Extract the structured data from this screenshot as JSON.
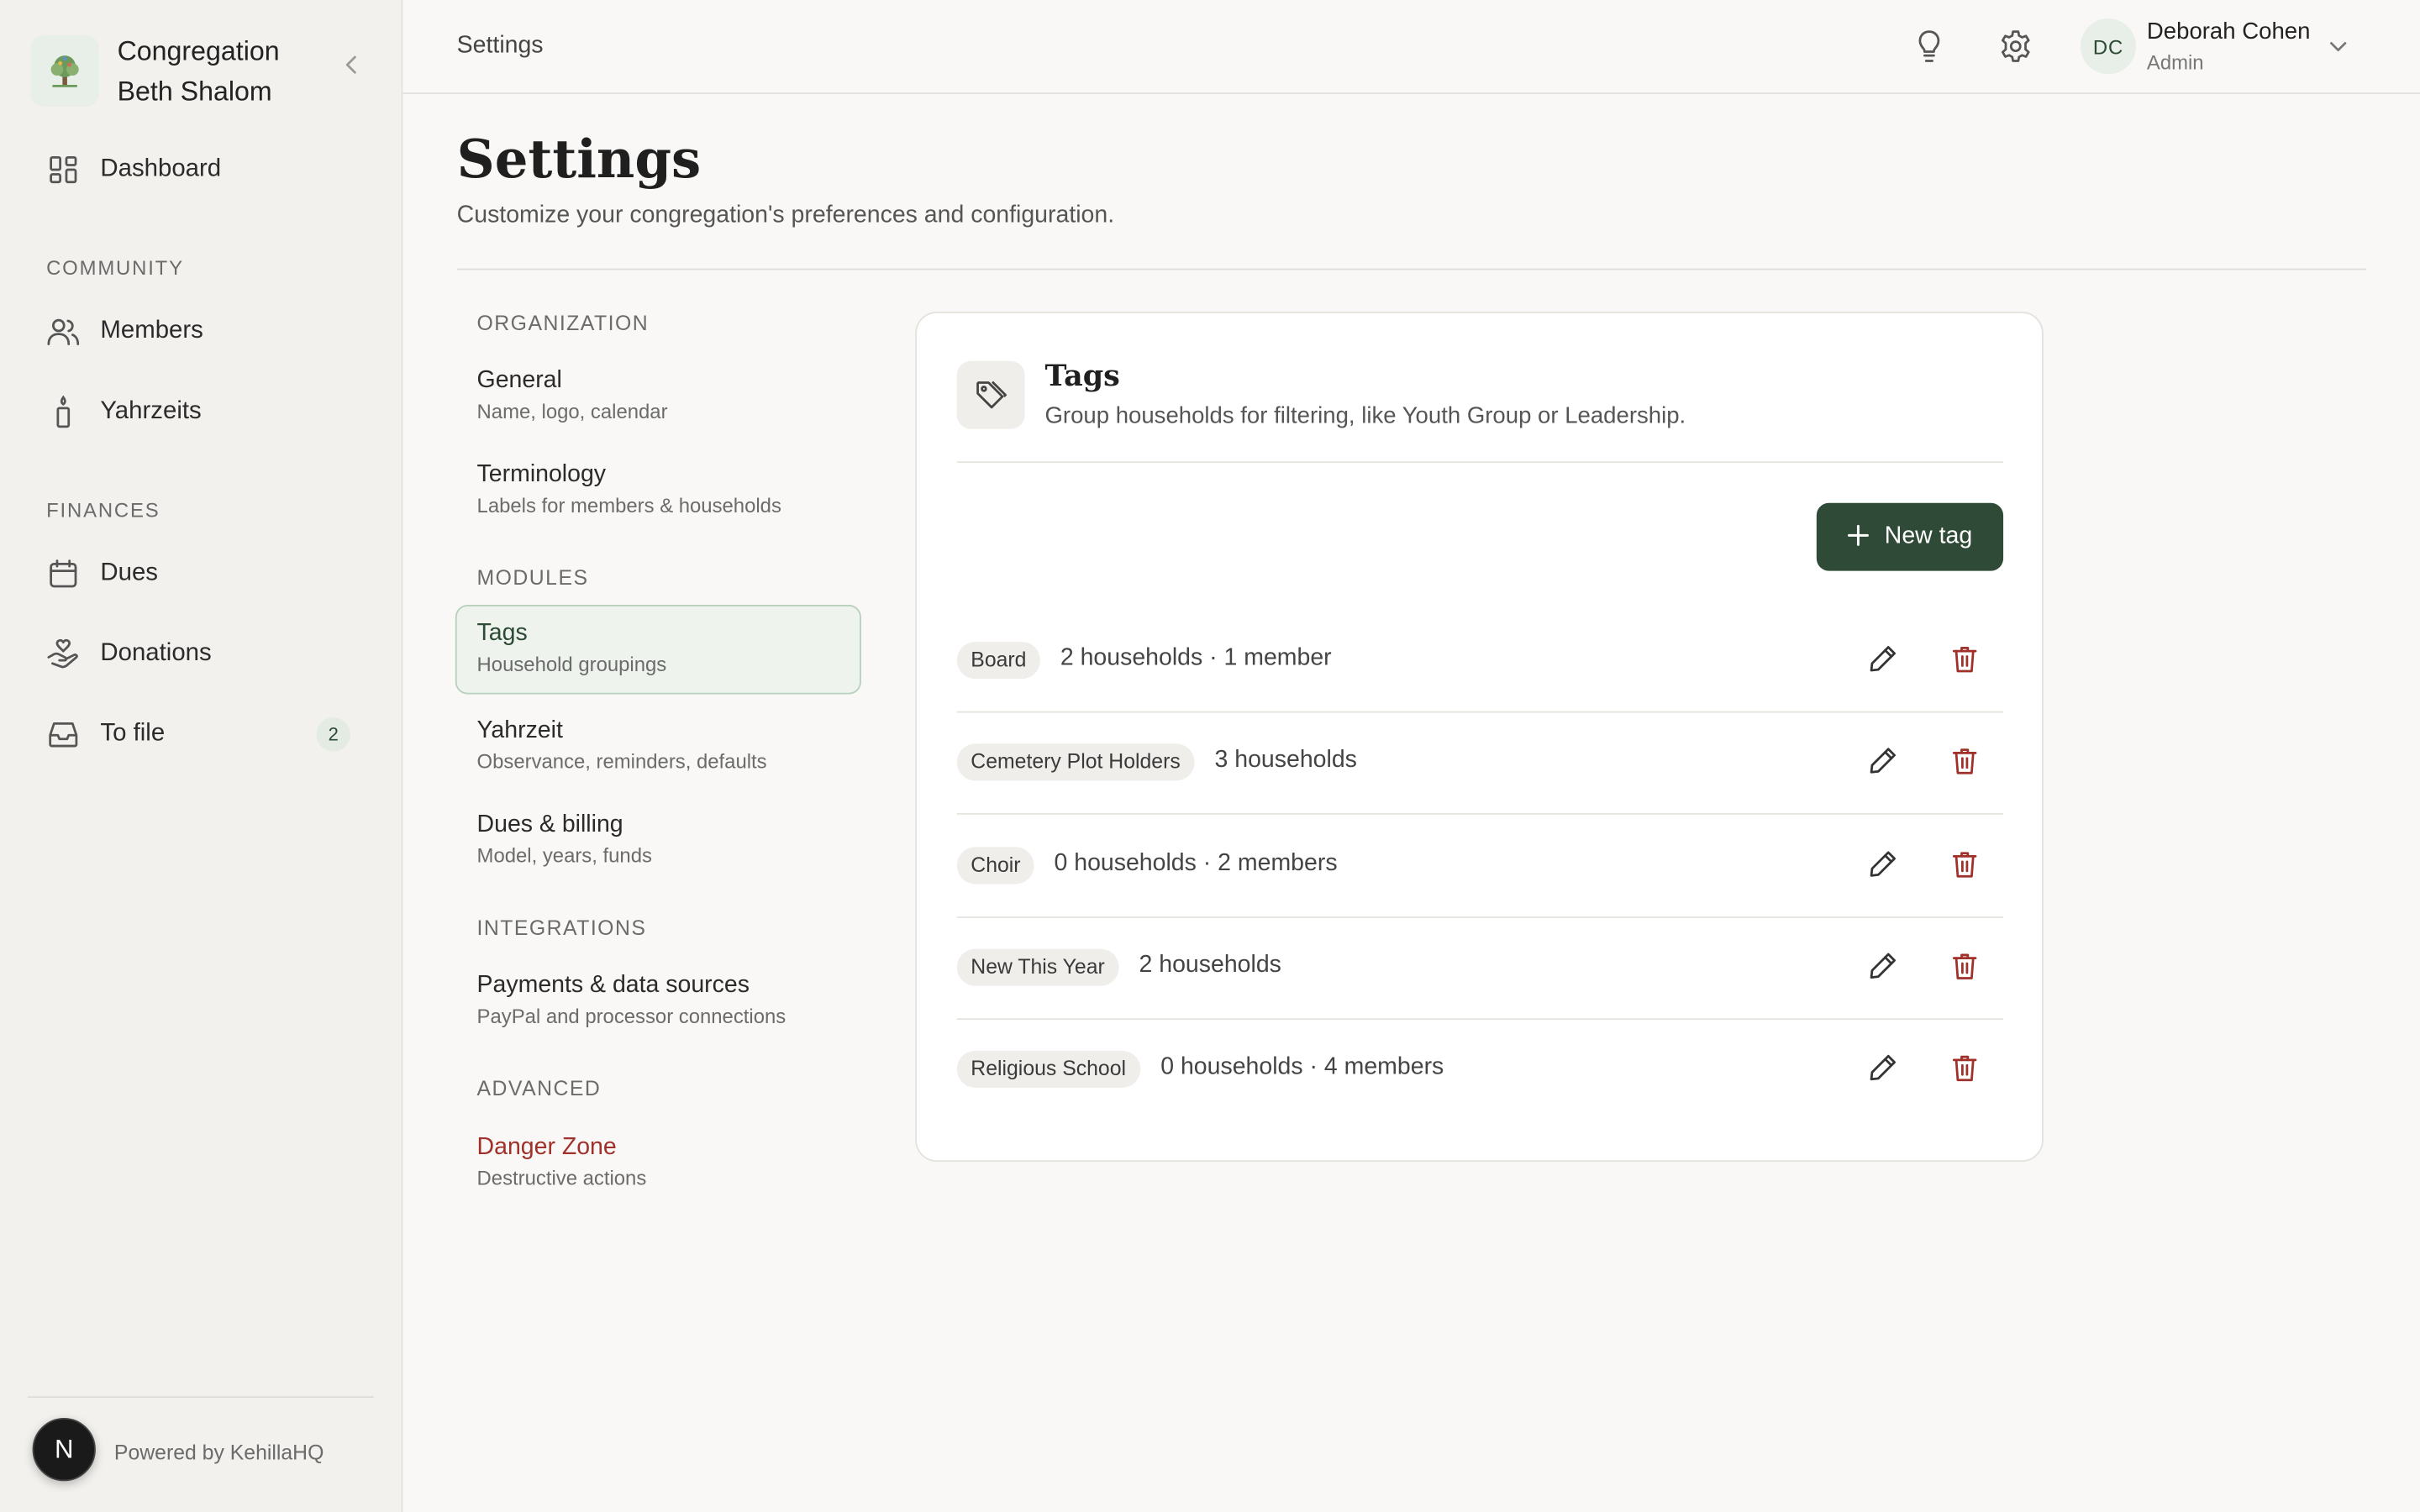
{
  "app": {
    "org_name": "Congregation Beth Shalom",
    "powered_by": "Powered by KehillaHQ",
    "footer_avatar": "N"
  },
  "sidebar": {
    "dashboard": "Dashboard",
    "sections": {
      "community": "COMMUNITY",
      "finances": "FINANCES"
    },
    "items": {
      "members": "Members",
      "yahrzeits": "Yahrzeits",
      "dues": "Dues",
      "donations": "Donations",
      "to_file": "To file",
      "to_file_count": "2"
    }
  },
  "topbar": {
    "breadcrumb": "Settings",
    "user_initials": "DC",
    "user_name": "Deborah Cohen",
    "user_role": "Admin"
  },
  "page": {
    "title": "Settings",
    "subtitle": "Customize your congregation's preferences and configuration."
  },
  "settings_nav": {
    "organization": "ORGANIZATION",
    "general": {
      "title": "General",
      "desc": "Name, logo, calendar"
    },
    "terminology": {
      "title": "Terminology",
      "desc": "Labels for members & households"
    },
    "modules": "MODULES",
    "tags": {
      "title": "Tags",
      "desc": "Household groupings"
    },
    "yahrzeit": {
      "title": "Yahrzeit",
      "desc": "Observance, reminders, defaults"
    },
    "dues_billing": {
      "title": "Dues & billing",
      "desc": "Model, years, funds"
    },
    "integrations": "INTEGRATIONS",
    "payments": {
      "title": "Payments & data sources",
      "desc": "PayPal and processor connections"
    },
    "advanced": "ADVANCED",
    "danger": {
      "title": "Danger Zone",
      "desc": "Destructive actions"
    }
  },
  "tags_card": {
    "title": "Tags",
    "subtitle": "Group households for filtering, like Youth Group or Leadership.",
    "new_button": "New tag",
    "rows": [
      {
        "name": "Board",
        "count": "2 households · 1 member"
      },
      {
        "name": "Cemetery Plot Holders",
        "count": "3 households"
      },
      {
        "name": "Choir",
        "count": "0 households · 2 members"
      },
      {
        "name": "New This Year",
        "count": "2 households"
      },
      {
        "name": "Religious School",
        "count": "0 households · 4 members"
      }
    ]
  },
  "colors": {
    "accent": "#2f4a36",
    "danger": "#a0302a",
    "active_bg": "#eef3ee"
  }
}
